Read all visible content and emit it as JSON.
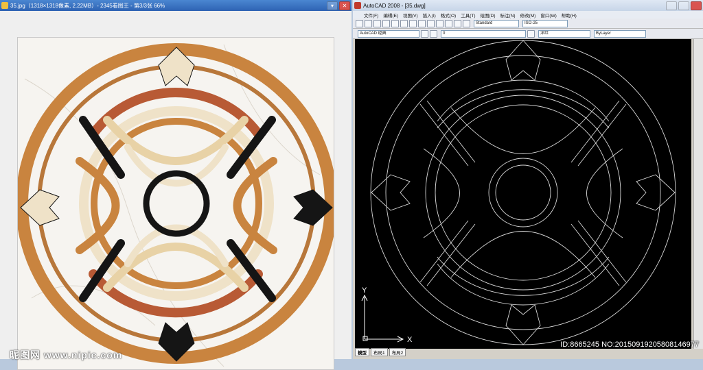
{
  "viewer": {
    "title": "35.jpg（1318×1318像素, 2.22MB）- 2345看图王 - 第3/3张 66%",
    "minimize_label": "▾",
    "close_label": "✕"
  },
  "watermark": "昵图网 www.nipic.com",
  "cad": {
    "title": "AutoCAD 2008 - [35.dwg]",
    "menu": [
      "文件(F)",
      "编辑(E)",
      "视图(V)",
      "插入(I)",
      "格式(O)",
      "工具(T)",
      "绘图(D)",
      "标注(N)",
      "修改(M)",
      "窗口(W)",
      "帮助(H)"
    ],
    "workspace": "AutoCAD 经典",
    "layer": "0",
    "text_style": "Standard",
    "dim_style": "ISO-25",
    "color": "洋红",
    "linetype": "ByLayer",
    "tabs": [
      "模型",
      "布局1",
      "布局2"
    ],
    "axis_x": "X",
    "axis_y": "Y"
  },
  "id_text": "ID:8665245 NO:20150919205808146977",
  "colors": {
    "wood": "#c9843f",
    "cream": "#efe2c8",
    "rust": "#b85a35",
    "black": "#151515",
    "cad_line": "#d8d8d8"
  }
}
